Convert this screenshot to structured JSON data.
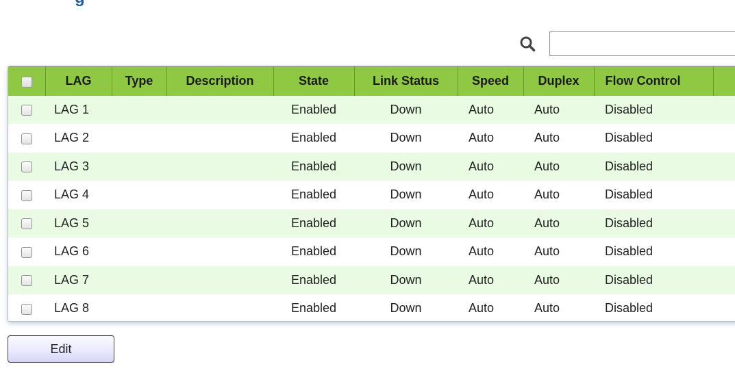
{
  "page": {
    "title_fragment": "g"
  },
  "search": {
    "icon": "search-icon",
    "value": "",
    "placeholder": ""
  },
  "table": {
    "columns": [
      "LAG",
      "Type",
      "Description",
      "State",
      "Link Status",
      "Speed",
      "Duplex",
      "Flow Control"
    ],
    "rows": [
      {
        "lag": "LAG 1",
        "type": "",
        "description": "",
        "state": "Enabled",
        "link_status": "Down",
        "speed": "Auto",
        "duplex": "Auto",
        "flow_control": "Disabled"
      },
      {
        "lag": "LAG 2",
        "type": "",
        "description": "",
        "state": "Enabled",
        "link_status": "Down",
        "speed": "Auto",
        "duplex": "Auto",
        "flow_control": "Disabled"
      },
      {
        "lag": "LAG 3",
        "type": "",
        "description": "",
        "state": "Enabled",
        "link_status": "Down",
        "speed": "Auto",
        "duplex": "Auto",
        "flow_control": "Disabled"
      },
      {
        "lag": "LAG 4",
        "type": "",
        "description": "",
        "state": "Enabled",
        "link_status": "Down",
        "speed": "Auto",
        "duplex": "Auto",
        "flow_control": "Disabled"
      },
      {
        "lag": "LAG 5",
        "type": "",
        "description": "",
        "state": "Enabled",
        "link_status": "Down",
        "speed": "Auto",
        "duplex": "Auto",
        "flow_control": "Disabled"
      },
      {
        "lag": "LAG 6",
        "type": "",
        "description": "",
        "state": "Enabled",
        "link_status": "Down",
        "speed": "Auto",
        "duplex": "Auto",
        "flow_control": "Disabled"
      },
      {
        "lag": "LAG 7",
        "type": "",
        "description": "",
        "state": "Enabled",
        "link_status": "Down",
        "speed": "Auto",
        "duplex": "Auto",
        "flow_control": "Disabled"
      },
      {
        "lag": "LAG 8",
        "type": "",
        "description": "",
        "state": "Enabled",
        "link_status": "Down",
        "speed": "Auto",
        "duplex": "Auto",
        "flow_control": "Disabled"
      }
    ]
  },
  "actions": {
    "edit_label": "Edit"
  },
  "colors": {
    "header_bg": "#8fc843",
    "row_alt_bg": "#e9fbe3",
    "title_blue": "#1f5fa8"
  }
}
